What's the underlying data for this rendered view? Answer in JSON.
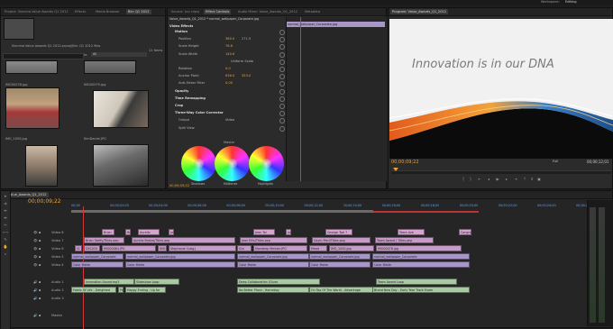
{
  "app": {
    "workspace_label": "Workspace:",
    "workspace_value": "Editing"
  },
  "project": {
    "tabs": [
      "Project: Illumina Value Awards Q1 2012",
      "Effects",
      "Media Browser",
      "Bin: Q1 2012"
    ],
    "bin_info": "Illumina Value Awards Q1 2012.prproj\\Bin: Q1 2012 files",
    "item_count": "11 Items",
    "search_in_label": "In:",
    "search_in_value": "All",
    "clips": [
      {
        "label": "IMG00078.jpg"
      },
      {
        "label": "IMG00079.jpg"
      },
      {
        "label": "IMG_1050.jpg"
      },
      {
        "label": "KimDaniel.JPG"
      },
      {
        "label": ""
      },
      {
        "label": ""
      }
    ]
  },
  "effects": {
    "tabs": [
      "Source: (no clips)",
      "Effect Controls",
      "Audio Mixer: Value_Awards_Q1_2012",
      "Metadata"
    ],
    "sequence_label": "Value_Awards_Q1_2012 * normal_wallpaper_Corporate.jpg",
    "clip_label": "normal_wallpaper_Corporate.jpg",
    "section_title": "Video Effects",
    "rows": [
      {
        "name": "Motion",
        "value": "",
        "type": "group"
      },
      {
        "name": "Position",
        "value": "360.0",
        "value2": "271.5",
        "type": "param"
      },
      {
        "name": "Scale Height",
        "value": "76.6",
        "type": "param"
      },
      {
        "name": "Scale Width",
        "value": "140.6",
        "type": "param"
      },
      {
        "name": "",
        "value": "Uniform Scale",
        "type": "check"
      },
      {
        "name": "Rotation",
        "value": "0.0",
        "type": "param"
      },
      {
        "name": "Anchor Point",
        "value": "636.0",
        "value2": "353.0",
        "type": "param"
      },
      {
        "name": "Anti-flicker Filter",
        "value": "0.00",
        "type": "param"
      },
      {
        "name": "Opacity",
        "value": "",
        "type": "group"
      },
      {
        "name": "Time Remapping",
        "value": "",
        "type": "group"
      },
      {
        "name": "Crop",
        "value": "",
        "type": "group"
      },
      {
        "name": "Three-Way Color Corrector",
        "value": "",
        "type": "group"
      },
      {
        "name": "Output",
        "value": "Video",
        "type": "param"
      },
      {
        "name": "Split View",
        "value": "",
        "type": "check"
      }
    ],
    "master_label": "Master",
    "wheel_labels": [
      "Shadows",
      "Midtones",
      "Highlights"
    ],
    "timecode": "00;00;09;22"
  },
  "program": {
    "tab": "Program: Value_Awards_Q1_2012",
    "headline": "Innovation is in our DNA",
    "timecode_current": "00;00;09;22",
    "fit_label": "Full",
    "timecode_duration": "00;00;12;01"
  },
  "timeline": {
    "tab": "Value_Awards_Q1_2012",
    "timecode": "00;00;09;22",
    "ruler": [
      "00;00",
      "00;00;02;00",
      "00;00;04;00",
      "00;00;06;00",
      "00;00;08;00",
      "00;00;10;00",
      "00;00;12;00",
      "00;00;14;00",
      "00;00;16;00",
      "00;00;18;00",
      "00;00;20;00",
      "00;00;22;00",
      "00;00;24;00",
      "00;00;26;00"
    ],
    "video_tracks": [
      "Video 8",
      "Video 7",
      "Video 6",
      "Video 5",
      "Video 4",
      "Video 3",
      "Video 2",
      "Video 1"
    ],
    "audio_tracks": [
      "Audio 1",
      "Audio 2",
      "Audio 3",
      "Master"
    ],
    "v8_clips": [
      "Brian",
      "Br",
      "Aurelio",
      "Jo",
      "Jean Tai",
      "Jo",
      "George Tsai ?",
      "Team Ave",
      "Congra"
    ],
    "v7_clips": [
      "Brian Steffy/Titles.aep",
      "Aurelio Bretzo/Titles.aep",
      "Jean Ellis/Titles.aep",
      "Gavin Pieri/Titles.aep",
      "Team Award / Titles.aep"
    ],
    "v6_clips": [
      "Gl",
      "DSC034",
      "IMG00064.JPG",
      "IMG",
      "Stephanie Craig.j",
      "Gre",
      "Mandeep Meister.JPG",
      "Mead",
      "IMG_1050.jpg",
      "IMG00078.jpg"
    ],
    "v5_clips": [
      "normal_wallpaper_Corporate",
      "normal_wallpaper_Corporate.jpg",
      "normal_wallpaper_Corporate.jpg",
      "normal_wallpaper_Corporate.jpg",
      "normal_wallpaper_Corporate"
    ],
    "v4_label": "Color Matte",
    "audio1_clips": [
      "Innovation Sound.mp3",
      "Slideshow Loop",
      "Deep Collaboration (Clues",
      "Team Award Loop"
    ],
    "audio2_clips": [
      "Fabric Of Life - Delighted",
      "Pal",
      "Happy Ending - Up for",
      "No Better Place - Homeboy",
      "On Top Of The World - Advantage",
      "Brand New Day - Early Year Track Exam"
    ]
  },
  "colors": {
    "accent": "#e7a33a",
    "panel": "#2b2b2b",
    "ruler_blue": "#6fa0e0",
    "playhead": "#d23a3a"
  }
}
